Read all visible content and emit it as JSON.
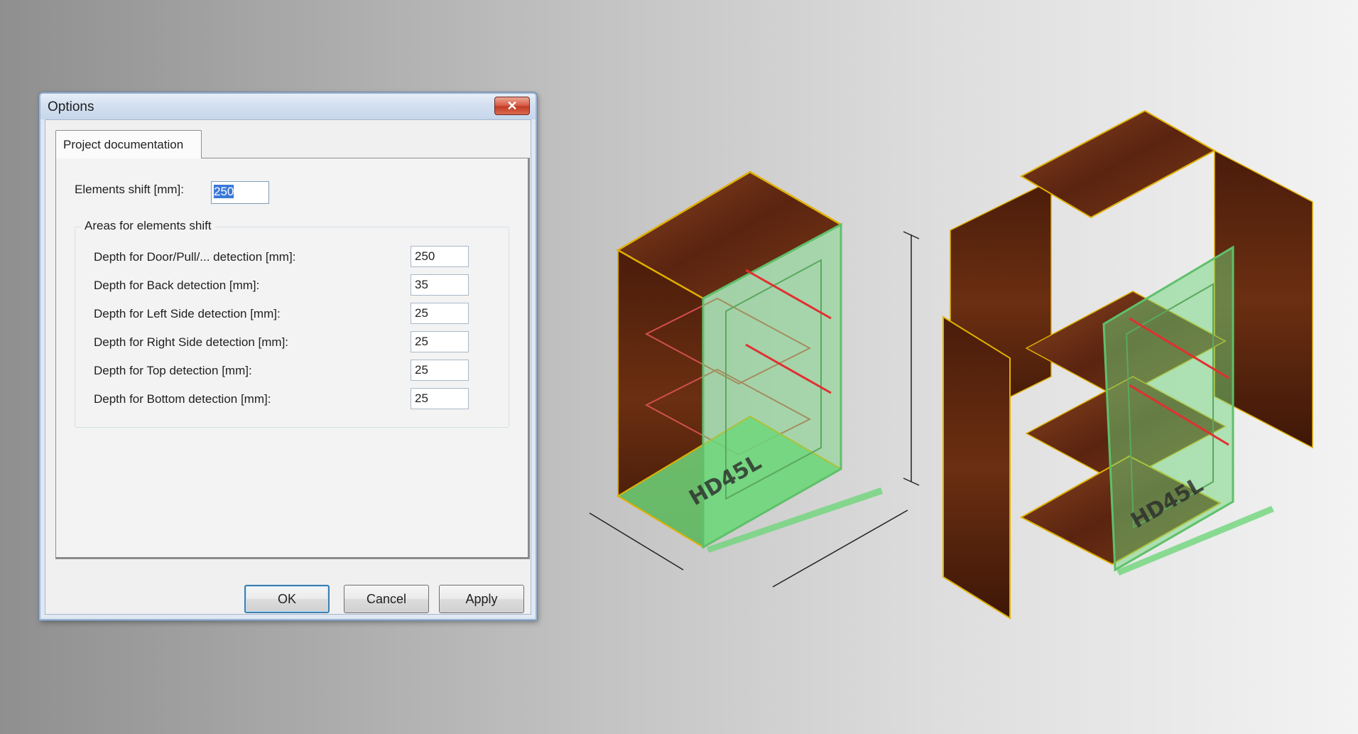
{
  "dialog": {
    "title": "Options",
    "close_glyph": "✕",
    "tab_label": "Project documentation",
    "elements_shift": {
      "label": "Elements shift [mm]:",
      "value": "250"
    },
    "group_title": "Areas for elements shift",
    "rows": [
      {
        "label": "Depth for Door/Pull/... detection [mm]:",
        "value": "250"
      },
      {
        "label": "Depth for Back detection [mm]:",
        "value": "35"
      },
      {
        "label": "Depth for Left Side detection [mm]:",
        "value": "25"
      },
      {
        "label": "Depth for Right Side detection [mm]:",
        "value": "25"
      },
      {
        "label": "Depth for Top detection [mm]:",
        "value": "25"
      },
      {
        "label": "Depth for Bottom detection [mm]:",
        "value": "25"
      }
    ],
    "buttons": {
      "ok": "OK",
      "cancel": "Cancel",
      "apply": "Apply"
    }
  },
  "illustration": {
    "cabinet_label_left": "HD45L",
    "cabinet_label_right": "HD45L",
    "colors": {
      "wood": "#6b2f12",
      "wood_light": "#8a4520",
      "glass": "#6fd67a",
      "edge": "#e0b000",
      "marker": "#e03030"
    }
  }
}
